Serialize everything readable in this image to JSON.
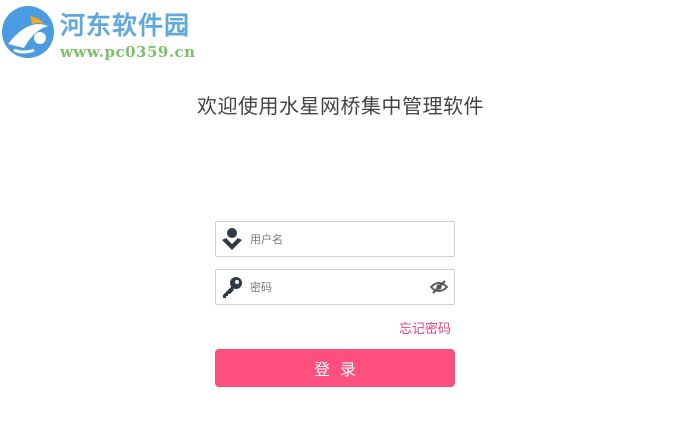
{
  "watermark": {
    "name": "河东软件园",
    "url": "www.pc0359.cn"
  },
  "welcome_text": "欢迎使用水星网桥集中管理软件",
  "login_form": {
    "username": {
      "placeholder": "用户名",
      "value": "",
      "icon": "user-icon"
    },
    "password": {
      "placeholder": "密码",
      "value": "",
      "icon": "key-icon",
      "toggle_icon": "eye-slash-icon"
    },
    "forgot_password_label": "忘记密码",
    "submit_label": "登录"
  },
  "colors": {
    "accent": "#ff4f7e",
    "forgot_link": "#e0457b",
    "watermark_blue": "#5fa8e0",
    "watermark_green": "#7cc06b"
  }
}
